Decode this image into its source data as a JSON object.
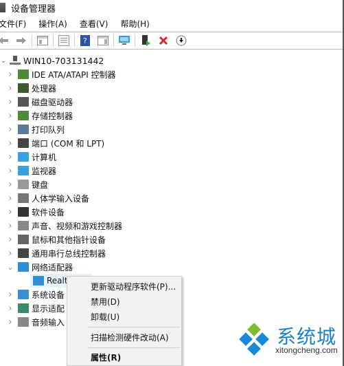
{
  "window": {
    "title": "设备管理器"
  },
  "menu": [
    "文件(F)",
    "操作(A)",
    "查看(V)",
    "帮助(H)"
  ],
  "toolbar": {
    "buttons": [
      "back-icon",
      "forward-icon",
      "show-hide-console-tree-icon",
      "properties-icon",
      "help-icon",
      "action-pane-icon",
      "scan-hardware-icon",
      "update-driver-icon",
      "uninstall-icon",
      "disable-icon"
    ]
  },
  "tree": {
    "root": "WIN10-703131442",
    "items": [
      {
        "label": "IDE ATA/ATAPI 控制器",
        "icon": "ide-controller-icon",
        "expanded": false
      },
      {
        "label": "处理器",
        "icon": "processor-icon",
        "expanded": false
      },
      {
        "label": "磁盘驱动器",
        "icon": "disk-drive-icon",
        "expanded": false
      },
      {
        "label": "存储控制器",
        "icon": "storage-controller-icon",
        "expanded": false
      },
      {
        "label": "打印队列",
        "icon": "printer-icon",
        "expanded": false
      },
      {
        "label": "端口 (COM 和 LPT)",
        "icon": "port-icon",
        "expanded": false
      },
      {
        "label": "计算机",
        "icon": "computer-icon",
        "expanded": false
      },
      {
        "label": "监视器",
        "icon": "monitor-icon",
        "expanded": false
      },
      {
        "label": "键盘",
        "icon": "keyboard-icon",
        "expanded": false
      },
      {
        "label": "人体学输入设备",
        "icon": "hid-icon",
        "expanded": false
      },
      {
        "label": "软件设备",
        "icon": "software-device-icon",
        "expanded": false
      },
      {
        "label": "声音、视频和游戏控制器",
        "icon": "sound-icon",
        "expanded": false
      },
      {
        "label": "鼠标和其他指针设备",
        "icon": "mouse-icon",
        "expanded": false
      },
      {
        "label": "通用串行总线控制器",
        "icon": "usb-icon",
        "expanded": false
      },
      {
        "label": "网络适配器",
        "icon": "network-adapter-icon",
        "expanded": true
      },
      {
        "label": "Realt",
        "icon": "network-adapter-icon",
        "child": true,
        "selected": true
      },
      {
        "label": "系统设备",
        "icon": "system-device-icon",
        "expanded": false
      },
      {
        "label": "显示适配",
        "icon": "display-adapter-icon",
        "expanded": false
      },
      {
        "label": "音频输入",
        "icon": "audio-input-icon",
        "expanded": false
      }
    ]
  },
  "context_menu": {
    "items": [
      "更新驱动程序软件(P)...",
      "禁用(D)",
      "卸载(U)",
      "扫描检测硬件改动(A)",
      "属性(R)"
    ]
  },
  "watermark": {
    "brand": "系统城",
    "url": "xitongcheng.com"
  }
}
